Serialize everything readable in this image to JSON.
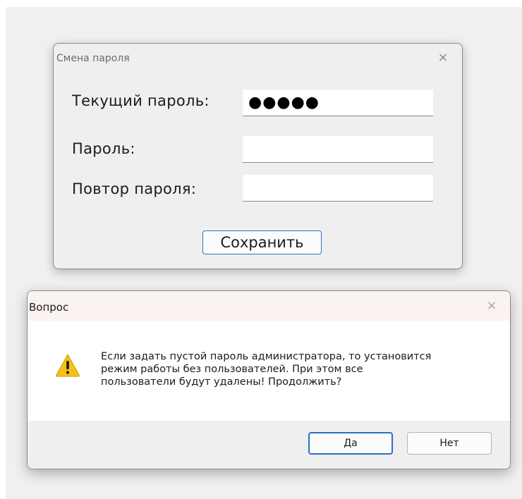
{
  "password_dialog": {
    "title": "Смена пароля",
    "close_glyph": "×",
    "fields": {
      "current_label": "Текущий пароль:",
      "current_value": "●●●●●",
      "new_label": "Пароль:",
      "new_value": "",
      "repeat_label": "Повтор пароля:",
      "repeat_value": ""
    },
    "save_label": "Сохранить"
  },
  "question_dialog": {
    "title": "Вопрос",
    "close_glyph": "×",
    "icon": "warning-icon",
    "message_lines": [
      "Если задать пустой пароль администратора, то установится",
      "режим работы без пользователей. При этом все",
      "пользователи будут удалены! Продолжить?"
    ],
    "yes_label": "Да",
    "no_label": "Нет"
  },
  "colors": {
    "accent": "#2b6fc3",
    "warning": "#f6c21a",
    "question_titlebar": "#fbf3ef"
  }
}
